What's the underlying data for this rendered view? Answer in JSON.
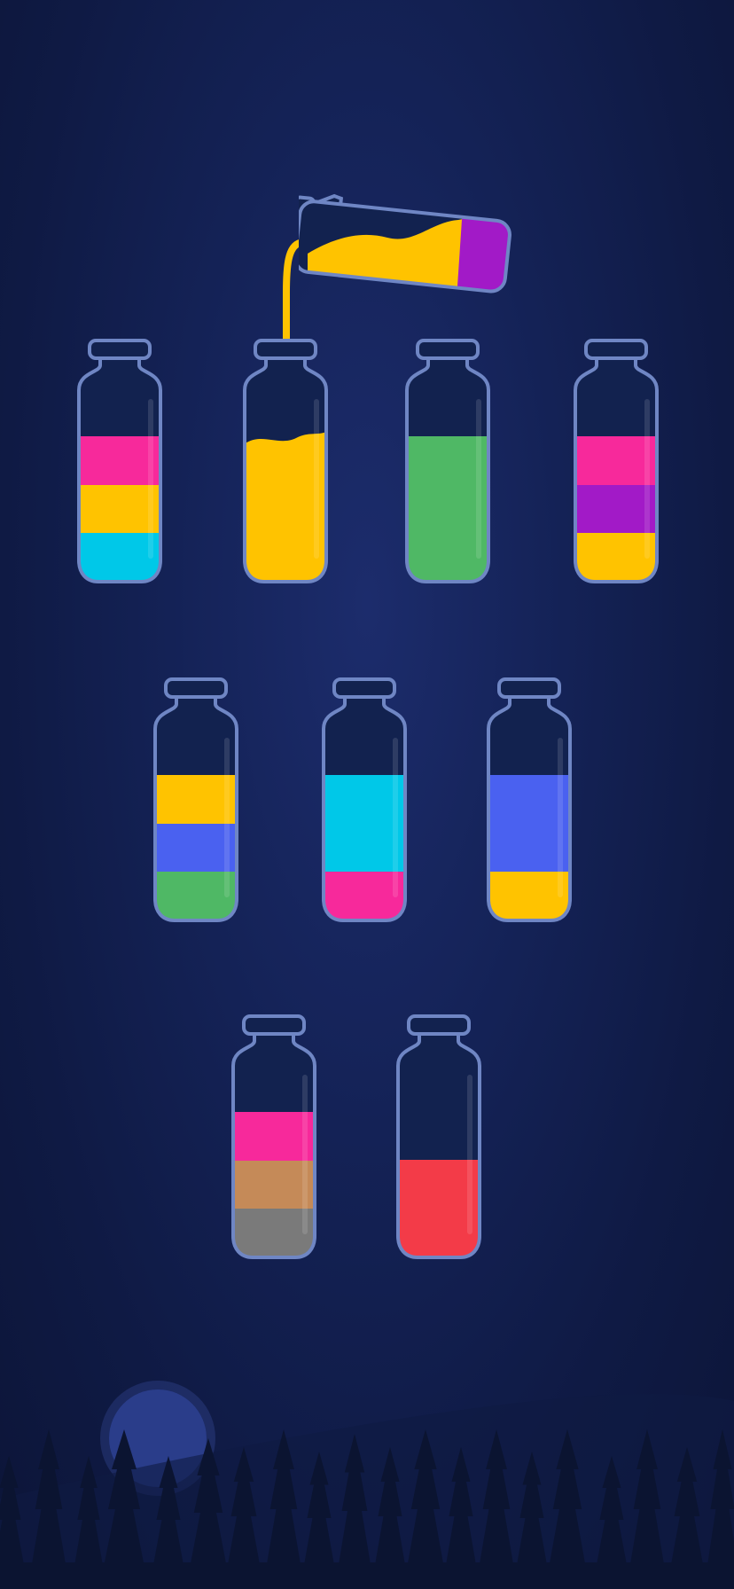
{
  "game": {
    "title": "",
    "colors": {
      "background": "#142256",
      "glass_outline": "#6f86c4",
      "bottle_empty": "#12224f",
      "pink": "#f7299b",
      "yellow": "#ffc300",
      "cyan": "#00c8e8",
      "green": "#4fb865",
      "purple": "#a21ac7",
      "blue": "#4a61f0",
      "brown": "#c58a58",
      "gray": "#7a7a7a",
      "red": "#f33b48"
    },
    "bottle_capacity": 4,
    "pouring": {
      "color": "yellow",
      "layers_bottom_to_top": [
        "purple",
        "yellow",
        "yellow"
      ],
      "target_bottle": 1
    },
    "rows": [
      {
        "bottles": [
          {
            "name": "bottle-1",
            "layers_bottom_to_top": [
              "cyan",
              "yellow",
              "pink"
            ]
          },
          {
            "name": "bottle-2",
            "layers_bottom_to_top": [
              "yellow",
              "yellow",
              "yellow"
            ]
          },
          {
            "name": "bottle-3",
            "layers_bottom_to_top": [
              "green",
              "green",
              "green"
            ]
          },
          {
            "name": "bottle-4",
            "layers_bottom_to_top": [
              "yellow",
              "purple",
              "pink"
            ]
          }
        ]
      },
      {
        "bottles": [
          {
            "name": "bottle-5",
            "layers_bottom_to_top": [
              "green",
              "blue",
              "yellow"
            ]
          },
          {
            "name": "bottle-6",
            "layers_bottom_to_top": [
              "pink",
              "cyan",
              "cyan"
            ]
          },
          {
            "name": "bottle-7",
            "layers_bottom_to_top": [
              "yellow",
              "blue",
              "blue"
            ]
          }
        ]
      },
      {
        "bottles": [
          {
            "name": "bottle-8",
            "layers_bottom_to_top": [
              "gray",
              "brown",
              "pink"
            ]
          },
          {
            "name": "bottle-9",
            "layers_bottom_to_top": [
              "red",
              "red"
            ]
          }
        ]
      }
    ],
    "scenery": {
      "moon": "moon-icon",
      "trees": "pine-tree-icon"
    }
  }
}
